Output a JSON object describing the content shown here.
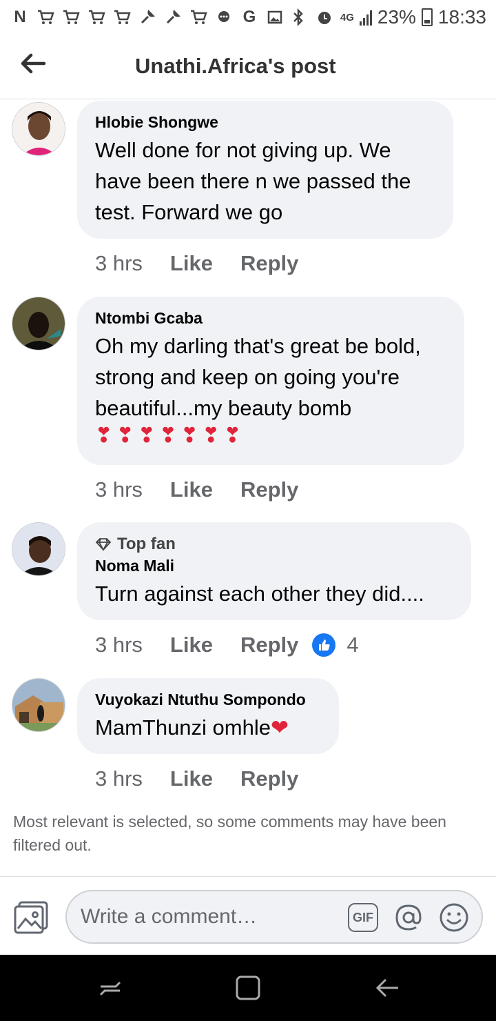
{
  "status_bar": {
    "left_icons": [
      "n-icon",
      "cart-icon",
      "cart-icon",
      "cart-icon",
      "cart-icon",
      "wrench-icon",
      "wrench-icon",
      "cart-icon",
      "message-icon",
      "google-g-icon",
      "image-icon"
    ],
    "network": "4G",
    "battery": "23%",
    "time": "18:33"
  },
  "header": {
    "title": "Unathi.Africa's post"
  },
  "comments": [
    {
      "author": "Hlobie Shongwe",
      "text": "Well done for not giving up. We have been there n we passed the test. Forward we go",
      "time": "3 hrs",
      "like_label": "Like",
      "reply_label": "Reply"
    },
    {
      "author": "Ntombi Gcaba",
      "text": "Oh my darling that's great be bold, strong and keep on going you're beautiful...my beauty bomb",
      "emoji": "❣❣❣❣❣❣❣",
      "time": "3 hrs",
      "like_label": "Like",
      "reply_label": "Reply"
    },
    {
      "badge": "Top fan",
      "author": "Noma Mali",
      "text": "Turn against each other they did....",
      "time": "3 hrs",
      "like_label": "Like",
      "reply_label": "Reply",
      "reaction_count": "4"
    },
    {
      "author": "Vuyokazi Ntuthu Sompondo",
      "text": "MamThunzi omhle",
      "emoji": "❤",
      "time": "3 hrs",
      "like_label": "Like",
      "reply_label": "Reply"
    }
  ],
  "filter_note": "Most relevant is selected, so some comments may have been filtered out.",
  "composer": {
    "placeholder": "Write a comment…",
    "gif_label": "GIF"
  },
  "colors": {
    "bubble": "#f0f2f5",
    "meta_text": "#65676b",
    "like_blue": "#1877f2",
    "heart_red": "#e0243a"
  }
}
